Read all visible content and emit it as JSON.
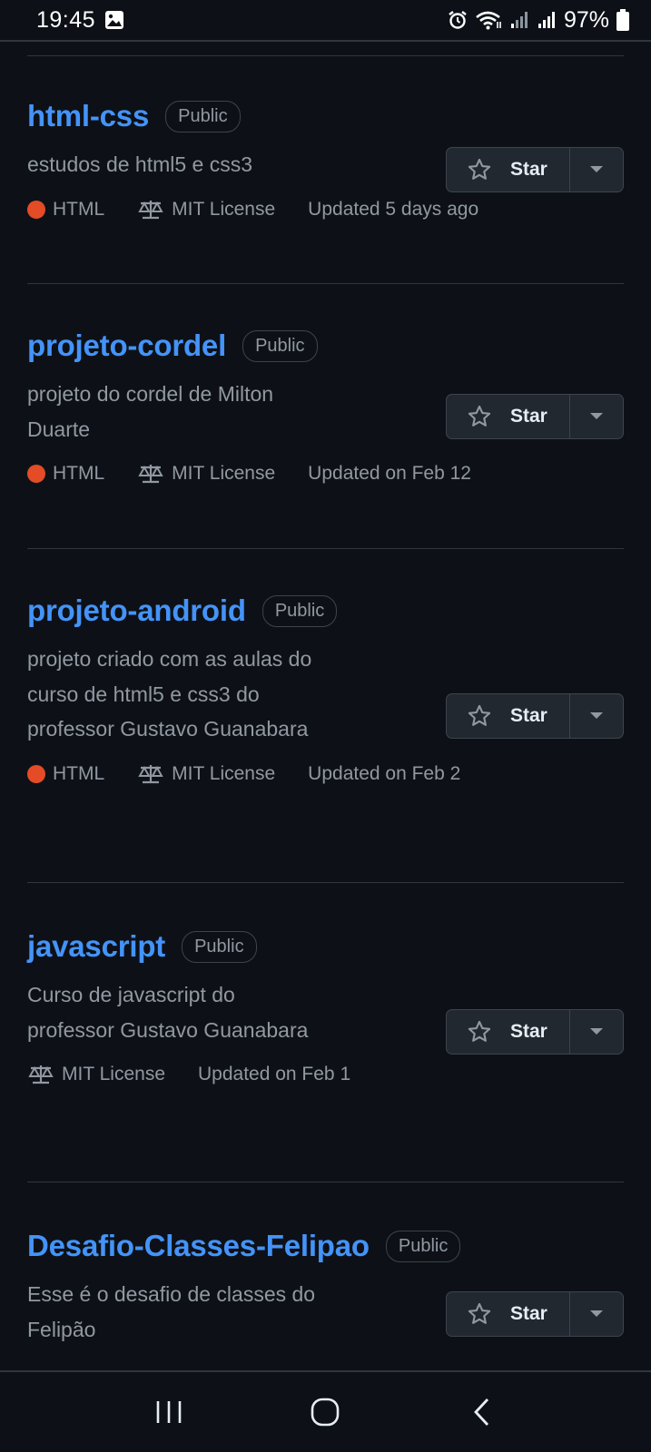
{
  "status_bar": {
    "time": "19:45",
    "battery": "97%",
    "icons": [
      "image-icon",
      "alarm-icon",
      "wifi-icon",
      "signal-icon",
      "signal-icon",
      "battery-icon"
    ]
  },
  "colors": {
    "background": "#0d1117",
    "link": "#4493f8",
    "muted": "#9198a1",
    "html_language": "#e34c26",
    "border": "#30363d"
  },
  "repos": [
    {
      "name": "html-css",
      "visibility": "Public",
      "description": "estudos de html5 e css3",
      "language": "HTML",
      "license": "MIT License",
      "updated": "Updated 5 days ago",
      "star_label": "Star"
    },
    {
      "name": "projeto-cordel",
      "visibility": "Public",
      "description": "projeto do cordel de Milton Duarte",
      "language": "HTML",
      "license": "MIT License",
      "updated": "Updated on Feb 12",
      "star_label": "Star"
    },
    {
      "name": "projeto-android",
      "visibility": "Public",
      "description": "projeto criado com as aulas do curso de html5 e css3 do professor Gustavo Guanabara",
      "language": "HTML",
      "license": "MIT License",
      "updated": "Updated on Feb 2",
      "star_label": "Star"
    },
    {
      "name": "javascript",
      "visibility": "Public",
      "description": "Curso de javascript do professor Gustavo Guanabara",
      "license": "MIT License",
      "updated": "Updated on Feb 1",
      "star_label": "Star"
    },
    {
      "name": "Desafio-Classes-Felipao",
      "visibility": "Public",
      "description": "Esse é o desafio de classes do Felipão",
      "star_label": "Star"
    }
  ],
  "nav_bar": {
    "buttons": [
      "recents-icon",
      "home-icon",
      "back-icon"
    ]
  }
}
